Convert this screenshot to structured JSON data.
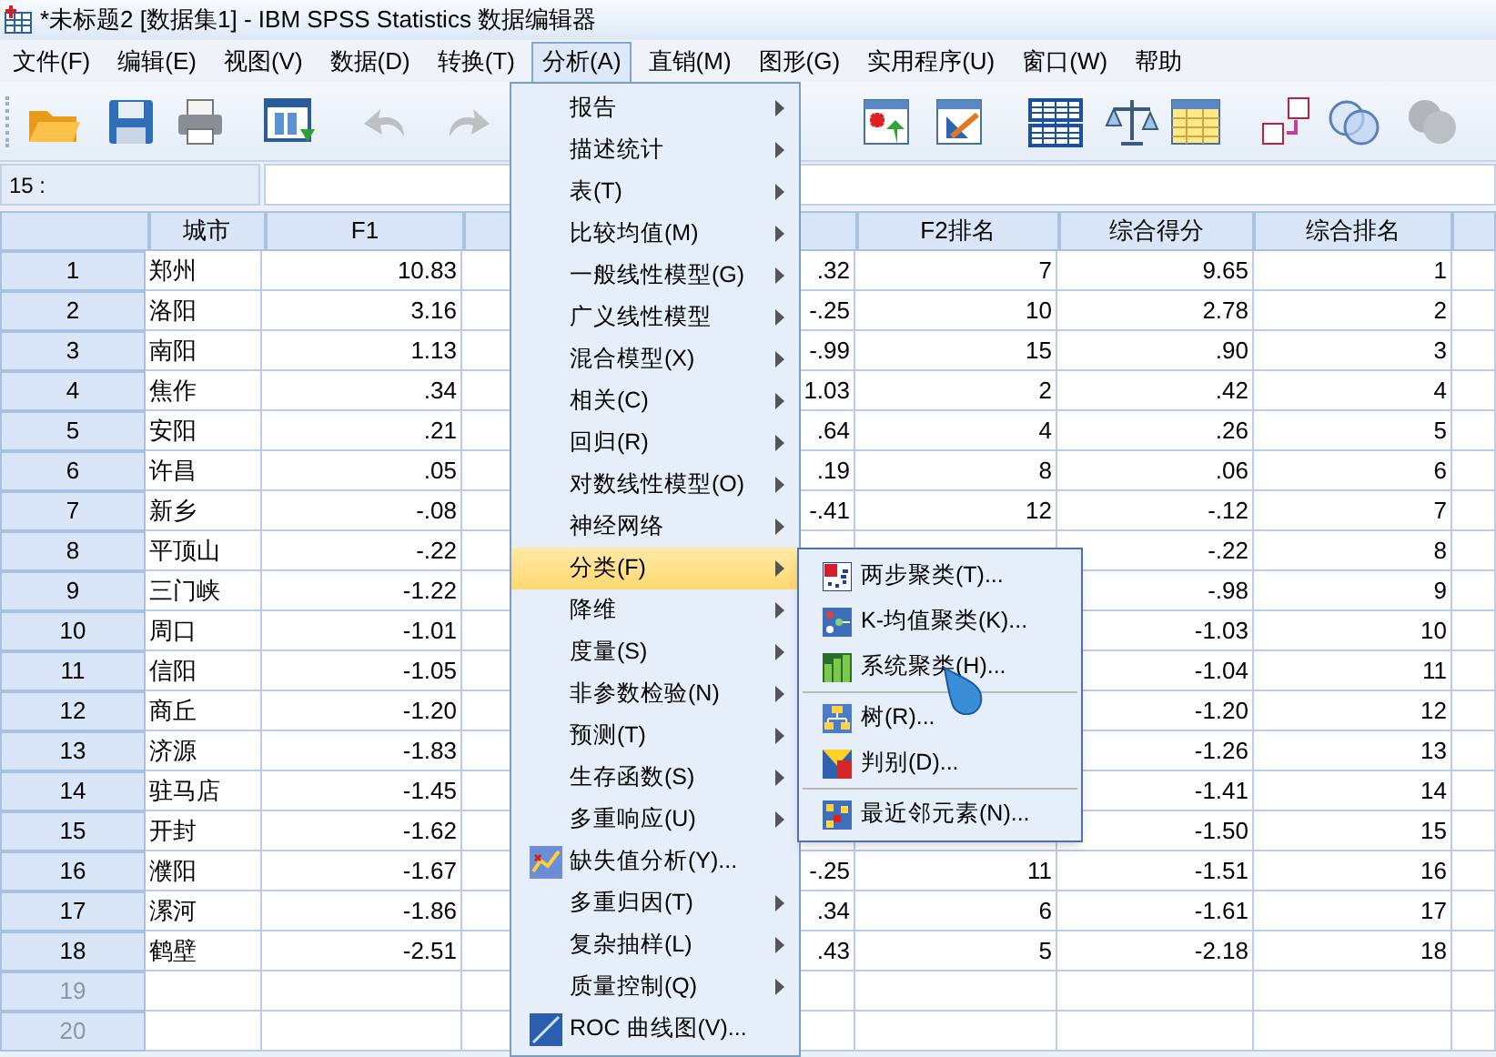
{
  "window": {
    "title": "*未标题2 [数据集1] - IBM SPSS Statistics 数据编辑器"
  },
  "menu_bar": [
    {
      "label": "文件(F)",
      "selected": false
    },
    {
      "label": "编辑(E)",
      "selected": false
    },
    {
      "label": "视图(V)",
      "selected": false
    },
    {
      "label": "数据(D)",
      "selected": false
    },
    {
      "label": "转换(T)",
      "selected": false
    },
    {
      "label": "分析(A)",
      "selected": true
    },
    {
      "label": "直销(M)",
      "selected": false
    },
    {
      "label": "图形(G)",
      "selected": false
    },
    {
      "label": "实用程序(U)",
      "selected": false
    },
    {
      "label": "窗口(W)",
      "selected": false
    },
    {
      "label": "帮助",
      "selected": false
    }
  ],
  "toolbar": [
    {
      "disabled": false
    },
    {
      "disabled": false
    },
    {
      "disabled": false
    },
    {
      "disabled": false
    },
    {
      "disabled": true
    },
    {
      "disabled": true
    },
    {
      "disabled": false
    },
    {
      "disabled": false
    },
    {
      "disabled": false
    },
    {
      "disabled": false
    },
    {
      "disabled": false
    },
    {
      "disabled": false
    },
    {
      "disabled": false
    },
    {
      "disabled": true
    }
  ],
  "cell_editor": {
    "cell_ref": "15 :"
  },
  "table": {
    "columns": [
      {
        "heading": "城市"
      },
      {
        "heading": "F1"
      },
      {},
      {
        "heading": "F2排名"
      },
      {
        "heading": "综合得分"
      },
      {
        "heading": "综合排名"
      },
      {}
    ],
    "rows": [
      {
        "number": "1",
        "empty": false,
        "cells": [
          "郑州",
          "10.83",
          ".32",
          "7",
          "9.65",
          "1"
        ]
      },
      {
        "number": "2",
        "empty": false,
        "cells": [
          "洛阳",
          "3.16",
          "-.25",
          "10",
          "2.78",
          "2"
        ]
      },
      {
        "number": "3",
        "empty": false,
        "cells": [
          "南阳",
          "1.13",
          "-.99",
          "15",
          ".90",
          "3"
        ]
      },
      {
        "number": "4",
        "empty": false,
        "cells": [
          "焦作",
          ".34",
          "1.03",
          "2",
          ".42",
          "4"
        ]
      },
      {
        "number": "5",
        "empty": false,
        "cells": [
          "安阳",
          ".21",
          ".64",
          "4",
          ".26",
          "5"
        ]
      },
      {
        "number": "6",
        "empty": false,
        "cells": [
          "许昌",
          ".05",
          ".19",
          "8",
          ".06",
          "6"
        ]
      },
      {
        "number": "7",
        "empty": false,
        "cells": [
          "新乡",
          "-.08",
          "-.41",
          "12",
          "-.12",
          "7"
        ]
      },
      {
        "number": "8",
        "empty": false,
        "cells": [
          "平顶山",
          "-.22",
          null,
          null,
          "-.22",
          "8"
        ]
      },
      {
        "number": "9",
        "empty": false,
        "cells": [
          "三门峡",
          "-1.22",
          null,
          null,
          "-.98",
          "9"
        ]
      },
      {
        "number": "10",
        "empty": false,
        "cells": [
          "周口",
          "-1.01",
          null,
          null,
          "-1.03",
          "10"
        ]
      },
      {
        "number": "11",
        "empty": false,
        "cells": [
          "信阳",
          "-1.05",
          null,
          null,
          "-1.04",
          "11"
        ]
      },
      {
        "number": "12",
        "empty": false,
        "cells": [
          "商丘",
          "-1.20",
          null,
          null,
          "-1.20",
          "12"
        ]
      },
      {
        "number": "13",
        "empty": false,
        "cells": [
          "济源",
          "-1.83",
          null,
          null,
          "-1.26",
          "13"
        ]
      },
      {
        "number": "14",
        "empty": false,
        "cells": [
          "驻马店",
          "-1.45",
          null,
          null,
          "-1.41",
          "14"
        ]
      },
      {
        "number": "15",
        "empty": false,
        "cells": [
          "开封",
          "-1.62",
          null,
          null,
          "-1.50",
          "15"
        ]
      },
      {
        "number": "16",
        "empty": false,
        "cells": [
          "濮阳",
          "-1.67",
          "-.25",
          "11",
          "-1.51",
          "16"
        ]
      },
      {
        "number": "17",
        "empty": false,
        "cells": [
          "漯河",
          "-1.86",
          ".34",
          "6",
          "-1.61",
          "17"
        ]
      },
      {
        "number": "18",
        "empty": false,
        "cells": [
          "鹤壁",
          "-2.51",
          ".43",
          "5",
          "-2.18",
          "18"
        ]
      },
      {
        "number": "19",
        "empty": true,
        "cells": []
      },
      {
        "number": "20",
        "empty": true,
        "cells": []
      }
    ]
  },
  "analyze_menu": [
    {
      "label": "报告",
      "kind": "submenu",
      "selected": false
    },
    {
      "label": "描述统计",
      "kind": "submenu",
      "selected": false
    },
    {
      "label": "表(T)",
      "kind": "submenu",
      "selected": false
    },
    {
      "label": "比较均值(M)",
      "kind": "submenu",
      "selected": false
    },
    {
      "label": "一般线性模型(G)",
      "kind": "submenu",
      "selected": false
    },
    {
      "label": "广义线性模型",
      "kind": "submenu",
      "selected": false
    },
    {
      "label": "混合模型(X)",
      "kind": "submenu",
      "selected": false
    },
    {
      "label": "相关(C)",
      "kind": "submenu",
      "selected": false
    },
    {
      "label": "回归(R)",
      "kind": "submenu",
      "selected": false
    },
    {
      "label": "对数线性模型(O)",
      "kind": "submenu",
      "selected": false
    },
    {
      "label": "神经网络",
      "kind": "submenu",
      "selected": false
    },
    {
      "label": "分类(F)",
      "kind": "submenu",
      "selected": true
    },
    {
      "label": "降维",
      "kind": "submenu",
      "selected": false
    },
    {
      "label": "度量(S)",
      "kind": "submenu",
      "selected": false
    },
    {
      "label": "非参数检验(N)",
      "kind": "submenu",
      "selected": false
    },
    {
      "label": "预测(T)",
      "kind": "submenu",
      "selected": false
    },
    {
      "label": "生存函数(S)",
      "kind": "submenu",
      "selected": false
    },
    {
      "label": "多重响应(U)",
      "kind": "submenu",
      "selected": false
    },
    {
      "label": "缺失值分析(Y)...",
      "kind": "dialog",
      "selected": false
    },
    {
      "label": "多重归因(T)",
      "kind": "submenu",
      "selected": false
    },
    {
      "label": "复杂抽样(L)",
      "kind": "submenu",
      "selected": false
    },
    {
      "label": "质量控制(Q)",
      "kind": "submenu",
      "selected": false
    },
    {
      "label": "ROC 曲线图(V)...",
      "kind": "dialog",
      "selected": false
    }
  ],
  "classify_submenu": [
    {
      "kind": "item",
      "label": "两步聚类(T)..."
    },
    {
      "kind": "item",
      "label": "K-均值聚类(K)..."
    },
    {
      "kind": "item",
      "label": "系统聚类(H)..."
    },
    {
      "kind": "separator"
    },
    {
      "kind": "item",
      "label": "树(R)..."
    },
    {
      "kind": "item",
      "label": "判别(D)..."
    },
    {
      "kind": "separator"
    },
    {
      "kind": "item",
      "label": "最近邻元素(N)..."
    }
  ]
}
